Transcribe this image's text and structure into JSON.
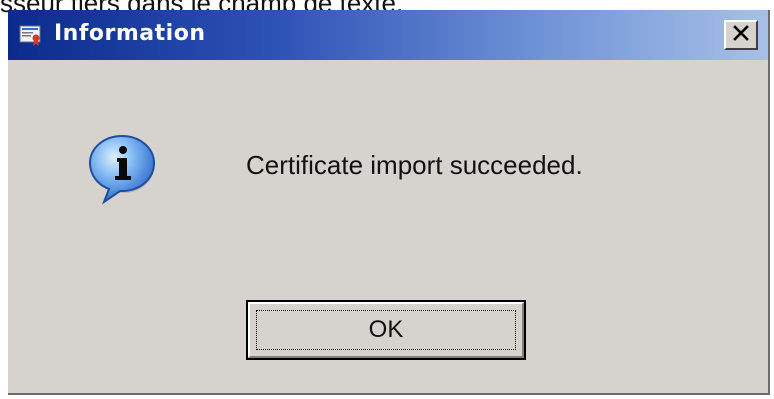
{
  "background_caption": "sseur tiers dans le champ de texte.",
  "dialog": {
    "title": "Information",
    "message": "Certificate import succeeded.",
    "ok_label": "OK",
    "close_glyph": "X",
    "icons": {
      "title_icon": "certificate-icon",
      "message_icon": "info-icon",
      "close_icon": "close-icon"
    }
  },
  "colors": {
    "titlebar_start": "#0b2a8c",
    "titlebar_end": "#a8c0e8",
    "dialog_face": "#d6d3ce",
    "info_bubble": "#4f93e8"
  }
}
